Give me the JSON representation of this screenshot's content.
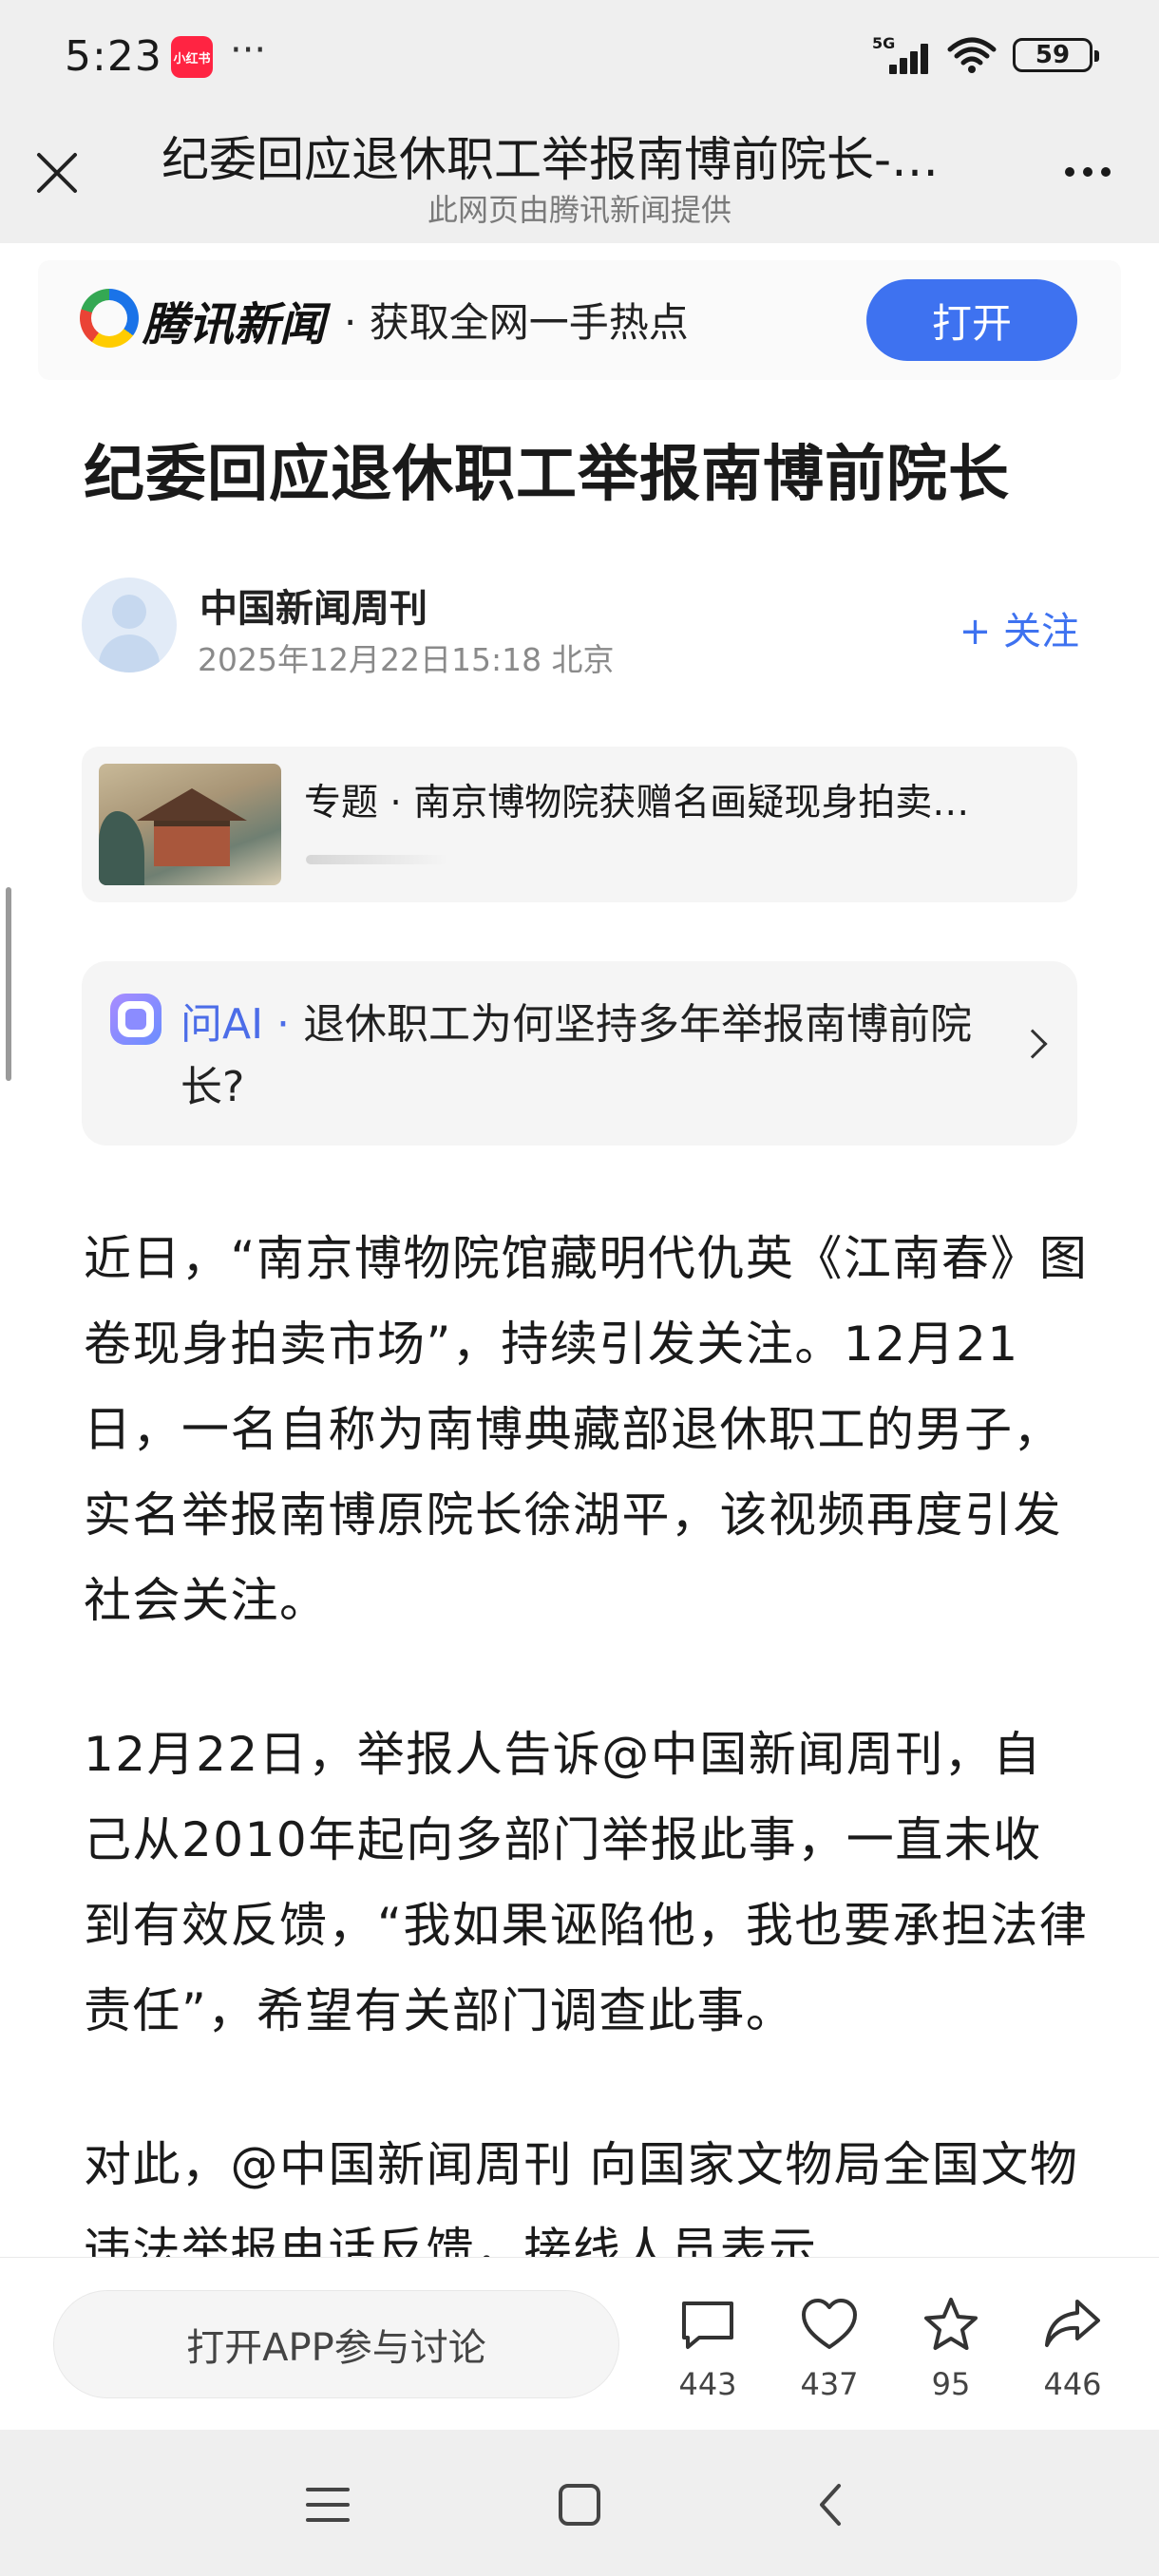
{
  "status_bar": {
    "time": "5:23",
    "app_icon_text": "小红书",
    "more_dots": "···",
    "network": "5G",
    "battery": "59"
  },
  "title_bar": {
    "title": "纪委回应退休职工举报南博前院长-…",
    "subtitle": "此网页由腾讯新闻提供"
  },
  "banner": {
    "brand": "腾讯新闻",
    "slogan": "· 获取全网一手热点",
    "open_label": "打开",
    "accent": "#3e72f0"
  },
  "article": {
    "title": "纪委回应退休职工举报南博前院长",
    "author": "中国新闻周刊",
    "meta": "2025年12月22日15:18  北京",
    "follow_label": "+ 关注",
    "topic": "专题 · 南京博物院获赠名画疑现身拍卖…",
    "ai_label": "问AI ·",
    "ai_question": "退休职工为何坚持多年举报南博前院长?",
    "paragraphs": [
      "近日，“南京博物院馆藏明代仇英《江南春》图卷现身拍卖市场”，持续引发关注。12月21日，一名自称为南博典藏部退休职工的男子，实名举报南博原院长徐湖平，该视频再度引发社会关注。",
      "12月22日，举报人告诉@中国新闻周刊，自己从2010年起向多部门举报此事，一直未收到有效反馈，“我如果诬陷他，我也要承担法律责任”，希望有关部门调查此事。",
      "对此，@中国新闻周刊 向国家文物局全国文物违法举报电话反馈，接线人员表示"
    ]
  },
  "bottom_bar": {
    "discuss_label": "打开APP参与讨论",
    "comments": "443",
    "likes": "437",
    "favorites": "95",
    "shares": "446"
  }
}
